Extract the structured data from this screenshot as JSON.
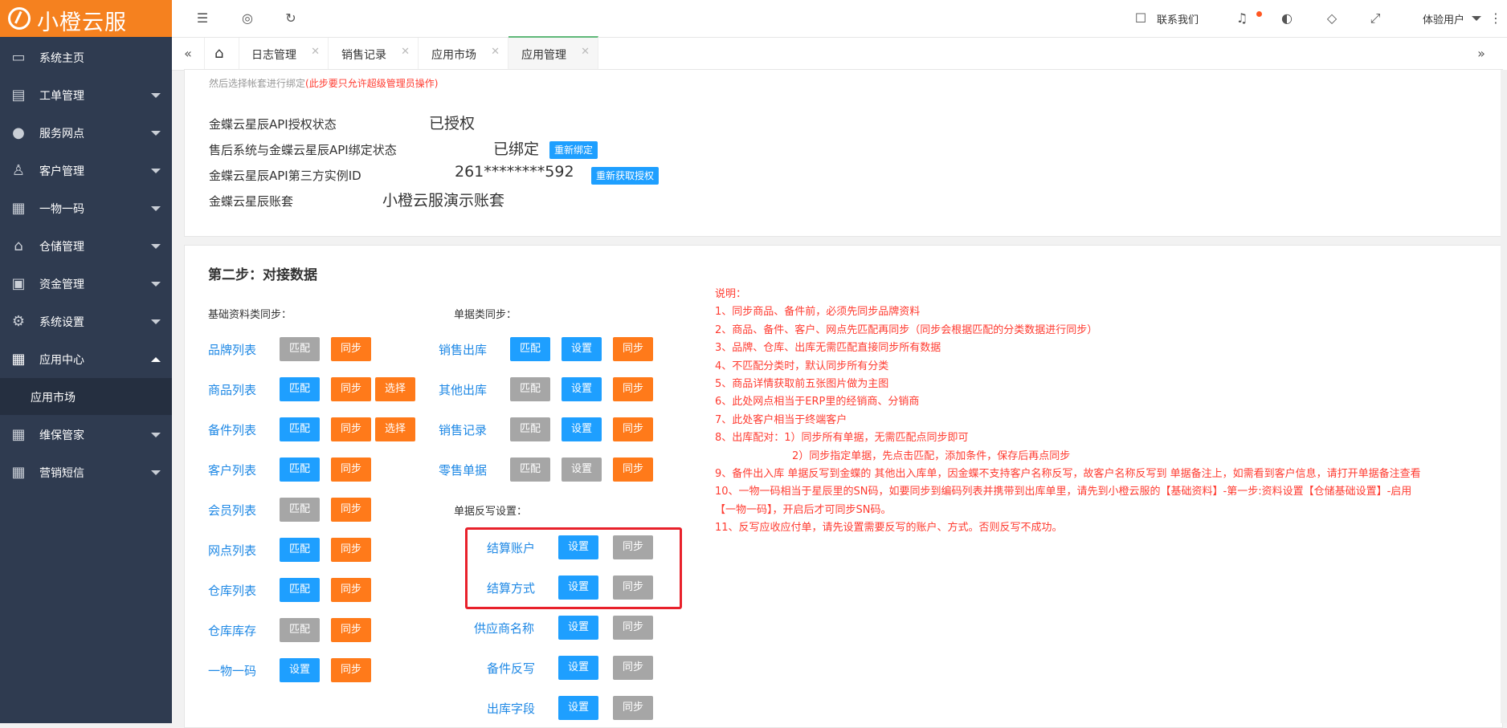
{
  "brand": {
    "name": "小橙云服"
  },
  "sidebar": {
    "items": [
      {
        "label": "系统主页",
        "icon": "monitor-icon"
      },
      {
        "label": "工单管理",
        "icon": "document-icon"
      },
      {
        "label": "服务网点",
        "icon": "globe-icon"
      },
      {
        "label": "客户管理",
        "icon": "user-icon"
      },
      {
        "label": "一物一码",
        "icon": "grid-icon"
      },
      {
        "label": "仓储管理",
        "icon": "bank-icon"
      },
      {
        "label": "资金管理",
        "icon": "money-icon"
      },
      {
        "label": "系统设置",
        "icon": "gear-icon"
      },
      {
        "label": "应用中心",
        "icon": "grid-icon"
      },
      {
        "label": "维保管家",
        "icon": "grid-icon"
      },
      {
        "label": "营销短信",
        "icon": "grid-icon"
      }
    ],
    "sub_item": "应用市场"
  },
  "topbar": {
    "contact": "联系我们",
    "user": "体验用户"
  },
  "tabs": [
    {
      "label": "日志管理"
    },
    {
      "label": "销售记录"
    },
    {
      "label": "应用市场"
    },
    {
      "label": "应用管理"
    }
  ],
  "step1": {
    "hint_line": "然后选择帐套进行绑定",
    "hint_red": "(此步要只允许超级管理员操作)",
    "rows": [
      {
        "key": "金蝶云星辰API授权状态",
        "value": "已授权"
      },
      {
        "key": "售后系统与金蝶云星辰API绑定状态",
        "value": "已绑定",
        "button": "重新绑定"
      },
      {
        "key": "金蝶云星辰API第三方实例ID",
        "value": "261********592",
        "button": "重新获取授权"
      },
      {
        "key": "金蝶云星辰账套",
        "value": "小橙云服演示账套"
      }
    ]
  },
  "step2": {
    "title": "第二步：对接数据",
    "basic_head": "基础资料类同步：",
    "doc_head": "单据类同步：",
    "writeback_head": "单据反写设置：",
    "basic_rows": [
      {
        "label": "品牌列表",
        "b1": "匹配",
        "b2": "同步"
      },
      {
        "label": "商品列表",
        "b1": "匹配",
        "b2": "同步",
        "b3": "选择"
      },
      {
        "label": "备件列表",
        "b1": "匹配",
        "b2": "同步",
        "b3": "选择"
      },
      {
        "label": "客户列表",
        "b1": "匹配",
        "b2": "同步"
      },
      {
        "label": "会员列表",
        "b1": "匹配",
        "b2": "同步"
      },
      {
        "label": "网点列表",
        "b1": "匹配",
        "b2": "同步"
      },
      {
        "label": "仓库列表",
        "b1": "匹配",
        "b2": "同步"
      },
      {
        "label": "仓库库存",
        "b1": "匹配",
        "b2": "同步"
      },
      {
        "label": "一物一码",
        "b1": "设置",
        "b2": "同步"
      }
    ],
    "doc_rows": [
      {
        "label": "销售出库",
        "b1": "匹配",
        "b2": "设置",
        "b3": "同步"
      },
      {
        "label": "其他出库",
        "b1": "匹配",
        "b2": "设置",
        "b3": "同步"
      },
      {
        "label": "销售记录",
        "b1": "匹配",
        "b2": "设置",
        "b3": "同步"
      },
      {
        "label": "零售单据",
        "b1": "匹配",
        "b2": "设置",
        "b3": "同步"
      }
    ],
    "writeback_rows": [
      {
        "label": "结算账户",
        "b1": "设置",
        "b2": "同步"
      },
      {
        "label": "结算方式",
        "b1": "设置",
        "b2": "同步"
      },
      {
        "label": "供应商名称",
        "b1": "设置",
        "b2": "同步"
      },
      {
        "label": "备件反写",
        "b1": "设置",
        "b2": "同步"
      },
      {
        "label": "出库字段",
        "b1": "设置",
        "b2": "同步"
      }
    ],
    "notes_title": "说明：",
    "notes": [
      "1、同步商品、备件前，必须先同步品牌资料",
      "2、商品、备件、客户、网点先匹配再同步（同步会根据匹配的分类数据进行同步）",
      "3、品牌、仓库、出库无需匹配直接同步所有数据",
      "4、不匹配分类时，默认同步所有分类",
      "5、商品详情获取前五张图片做为主图",
      "6、此处网点相当于ERP里的经销商、分销商",
      "7、此处客户相当于终端客户",
      "8、出库配对：1）同步所有单据，无需匹配点同步即可",
      "2）同步指定单据，先点击匹配，添加条件，保存后再点同步",
      "9、备件出入库 单据反写到金蝶的 其他出入库单，因金蝶不支持客户名称反写，故客户名称反写到 单据备注上，如需看到客户信息，请打开单据备注查看",
      "10、一物一码相当于星辰里的SN码，如要同步到编码列表并携带到出库单里，请先到小橙云服的【基础资料】-第一步:资料设置【仓储基础设置】-启用【一物一码】，开启后才可同步SN码。",
      "11、反写应收应付单，请先设置需要反写的账户、方式。否则反写不成功。"
    ]
  }
}
